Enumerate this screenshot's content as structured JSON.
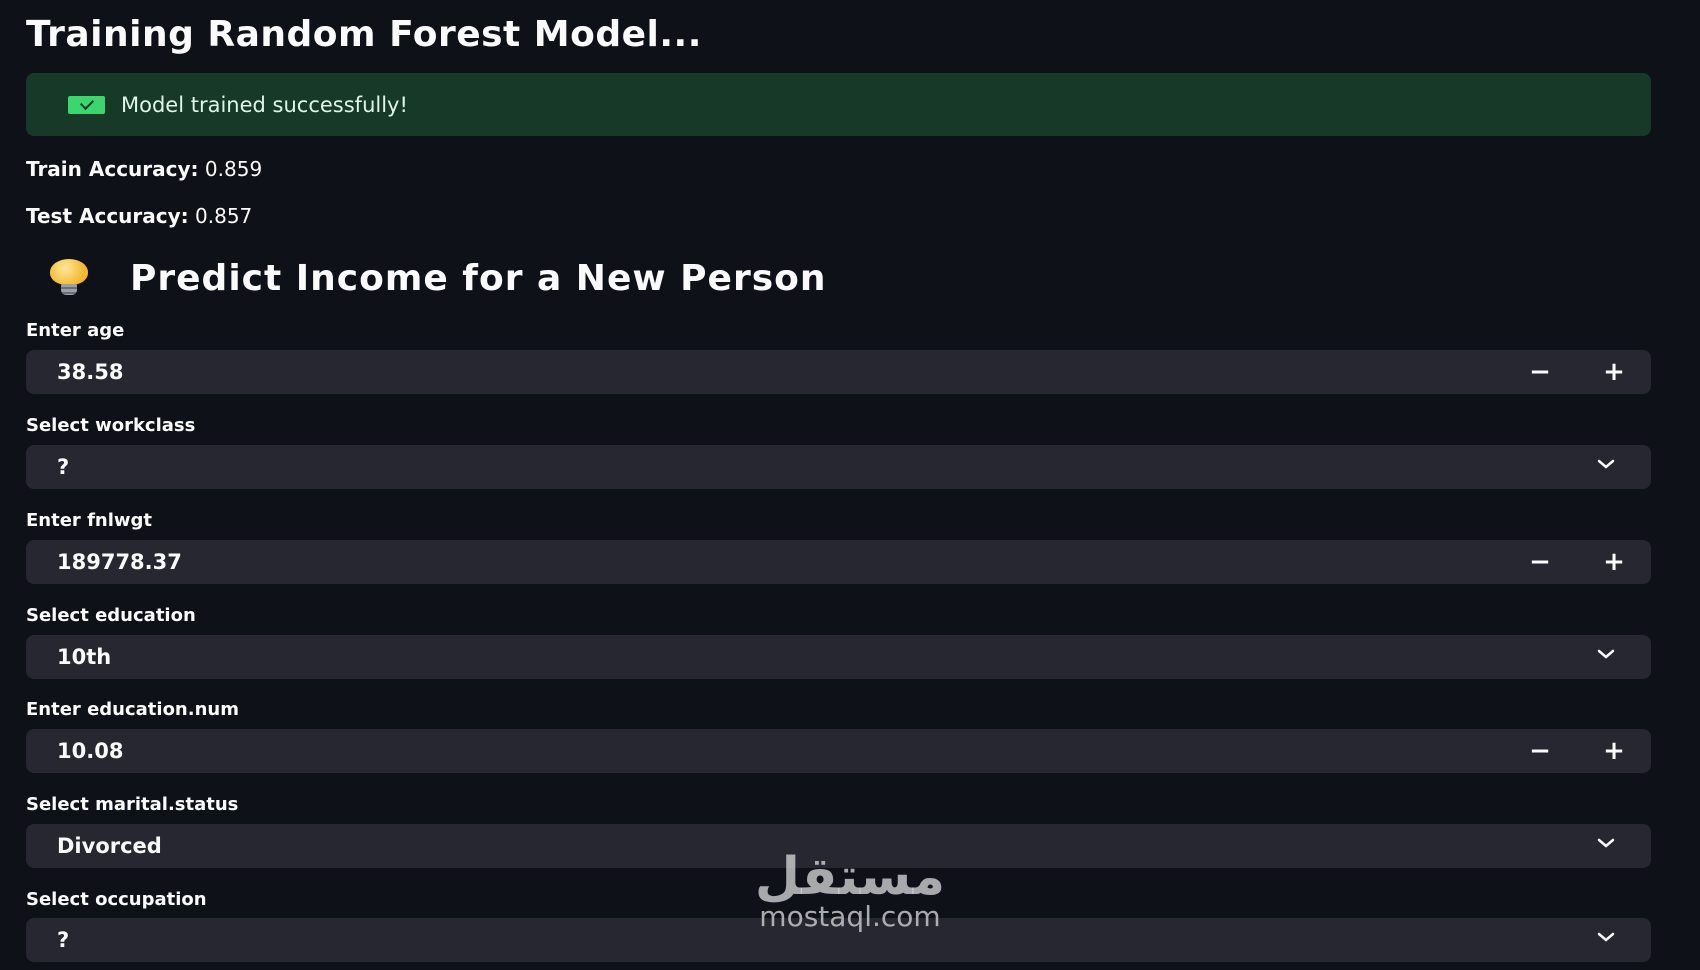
{
  "header": {
    "title": "Training Random Forest Model..."
  },
  "status": {
    "message": "Model trained successfully!",
    "icon": "check-square-icon",
    "color": "#3dd56d"
  },
  "metrics": {
    "train_label": "Train Accuracy:",
    "train_value": "0.859",
    "test_label": "Test Accuracy:",
    "test_value": "0.857"
  },
  "predict": {
    "title": "Predict Income for a New Person",
    "icon": "lightbulb-icon"
  },
  "fields": [
    {
      "label": "Enter age",
      "value": "38.58",
      "type": "number"
    },
    {
      "label": "Select workclass",
      "value": "?",
      "type": "select"
    },
    {
      "label": "Enter fnlwgt",
      "value": "189778.37",
      "type": "number"
    },
    {
      "label": "Select education",
      "value": "10th",
      "type": "select"
    },
    {
      "label": "Enter education.num",
      "value": "10.08",
      "type": "number"
    },
    {
      "label": "Select marital.status",
      "value": "Divorced",
      "type": "select"
    },
    {
      "label": "Select occupation",
      "value": "?",
      "type": "select"
    }
  ],
  "stepper": {
    "minus": "−",
    "plus": "+"
  },
  "watermark": {
    "arabic": "مستقل",
    "latin": "mostaql.com"
  }
}
